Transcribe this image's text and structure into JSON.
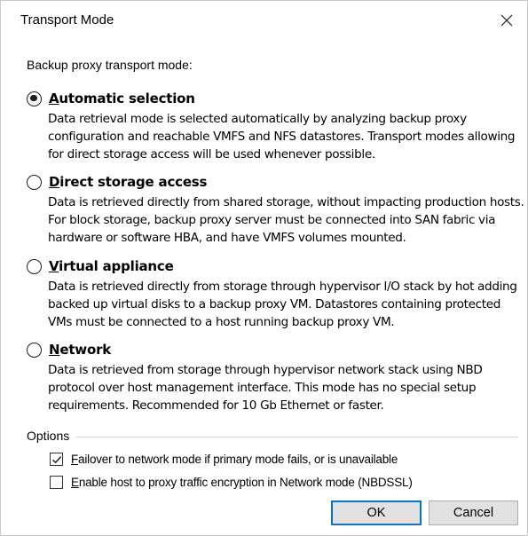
{
  "window": {
    "title": "Transport Mode"
  },
  "group_label": "Backup proxy transport mode:",
  "modes": [
    {
      "key": "automatic",
      "accel": "A",
      "rest": "utomatic selection",
      "checked": true,
      "description": "Data retrieval mode is selected automatically by analyzing backup proxy configuration and reachable VMFS and NFS datastores. Transport modes allowing for direct storage access will be used whenever possible."
    },
    {
      "key": "direct",
      "accel": "D",
      "rest": "irect storage access",
      "checked": false,
      "description": "Data is retrieved directly from shared storage, without impacting production hosts. For block storage, backup proxy server must be connected into SAN fabric via hardware or software HBA, and have VMFS volumes mounted."
    },
    {
      "key": "virtual",
      "accel": "V",
      "rest": "irtual appliance",
      "checked": false,
      "description": "Data is retrieved directly from storage through hypervisor I/O stack by hot adding backed up virtual disks to a backup proxy VM. Datastores containing protected VMs must be connected to a host running backup proxy VM."
    },
    {
      "key": "network",
      "accel": "N",
      "rest": "etwork",
      "checked": false,
      "description": "Data is retrieved from storage through hypervisor network stack using NBD protocol over host management interface. This mode has no special setup requirements. Recommended for 10 Gb Ethernet or faster."
    }
  ],
  "options": {
    "header": "Options",
    "failover": {
      "accel": "F",
      "rest": "ailover to network mode if primary mode fails, or is unavailable",
      "checked": true
    },
    "encryption": {
      "accel": "E",
      "rest": "nable host to proxy traffic encryption in Network mode (NBDSSL)",
      "checked": false
    }
  },
  "buttons": {
    "ok": "OK",
    "cancel": "Cancel"
  },
  "colors": {
    "default_button_border": "#0078d7",
    "button_face": "#e1e1e1"
  }
}
